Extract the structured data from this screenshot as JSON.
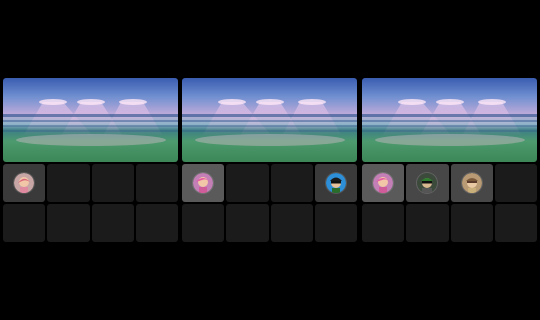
{
  "colors": {
    "background": "#000000",
    "slot_empty": "#1b1b1b",
    "slot_filled": "#3a3a3a",
    "slot_selected": "#5a5a5a"
  },
  "panels": [
    {
      "banner": "stadium-lights-banner",
      "slots": [
        {
          "state": "filled",
          "avatar": "pink-character-avatar"
        },
        {
          "state": "empty"
        },
        {
          "state": "empty"
        },
        {
          "state": "empty"
        },
        {
          "state": "empty"
        },
        {
          "state": "empty"
        },
        {
          "state": "empty"
        },
        {
          "state": "empty"
        }
      ]
    },
    {
      "banner": "stadium-lights-banner",
      "slots": [
        {
          "state": "selected",
          "avatar": "pink-character-avatar"
        },
        {
          "state": "empty"
        },
        {
          "state": "empty"
        },
        {
          "state": "filled",
          "avatar": "blue-character-avatar"
        },
        {
          "state": "empty"
        },
        {
          "state": "empty"
        },
        {
          "state": "empty"
        },
        {
          "state": "empty"
        }
      ]
    },
    {
      "banner": "stadium-lights-banner",
      "slots": [
        {
          "state": "selected",
          "avatar": "pink-character-avatar"
        },
        {
          "state": "filled",
          "avatar": "green-character-avatar"
        },
        {
          "state": "filled",
          "avatar": "tan-character-avatar"
        },
        {
          "state": "empty"
        },
        {
          "state": "empty"
        },
        {
          "state": "empty"
        },
        {
          "state": "empty"
        },
        {
          "state": "empty"
        }
      ]
    }
  ]
}
